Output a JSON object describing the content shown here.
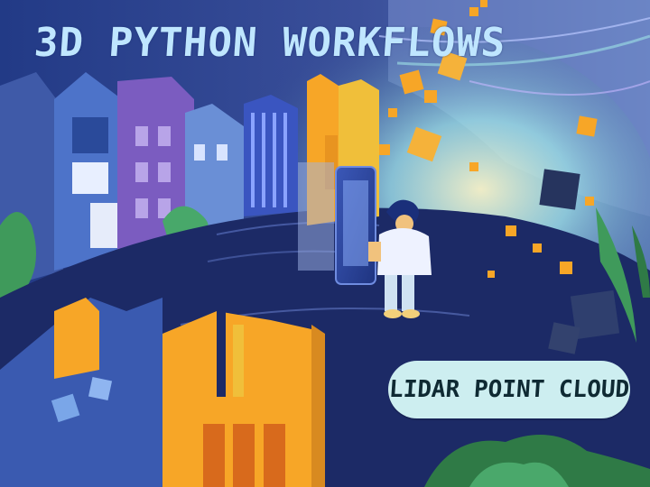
{
  "title": "3D PYTHON WORKFLOWS",
  "badge": "LIDAR POINT CLOUD",
  "colors": {
    "sky": "#2a3f8a",
    "ground": "#1c2a66",
    "orange": "#f7a627",
    "cyan_glow": "#9fe3e6",
    "pill": "#cdeef0",
    "title": "#bfe6ff"
  },
  "illustration": {
    "scene": "city-to-point-cloud",
    "figure": "person-with-tablet"
  }
}
